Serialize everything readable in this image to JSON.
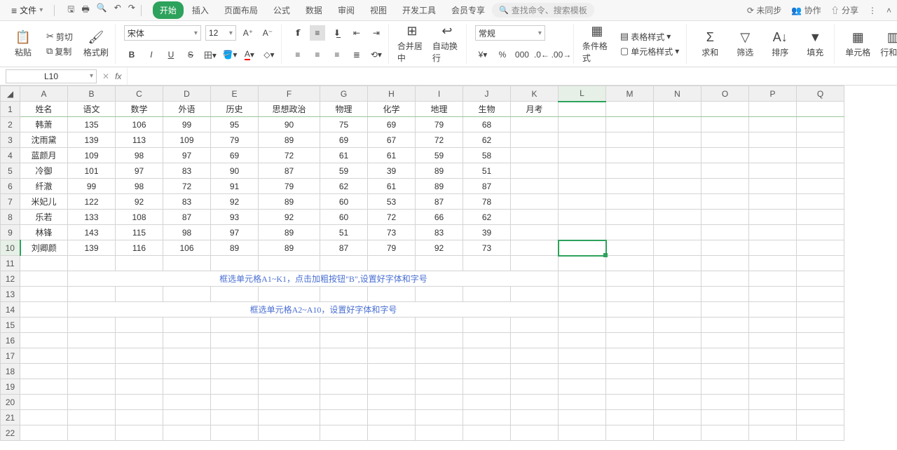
{
  "menubar": {
    "file": "文件",
    "tabs": [
      "开始",
      "插入",
      "页面布局",
      "公式",
      "数据",
      "审阅",
      "视图",
      "开发工具",
      "会员专享"
    ],
    "search_placeholder": "查找命令、搜索模板",
    "right": {
      "sync": "未同步",
      "collab": "协作",
      "share": "分享"
    }
  },
  "ribbon": {
    "paste": "粘贴",
    "cut": "剪切",
    "copy": "复制",
    "format_painter": "格式刷",
    "font_name": "宋体",
    "font_size": "12",
    "number_format": "常规",
    "merge_center": "合并居中",
    "wrap_text": "自动换行",
    "cond_format": "条件格式",
    "table_style": "表格样式",
    "cell_style": "单元格样式",
    "sum": "求和",
    "filter": "筛选",
    "sort": "排序",
    "fill": "填充",
    "cells": "单元格",
    "rowcol": "行和列"
  },
  "formula_bar": {
    "name_box": "L10",
    "fx": "fx"
  },
  "grid": {
    "columns": [
      "A",
      "B",
      "C",
      "D",
      "E",
      "F",
      "G",
      "H",
      "I",
      "J",
      "K",
      "L",
      "M",
      "N",
      "O",
      "P",
      "Q"
    ],
    "headers": [
      "姓名",
      "语文",
      "数学",
      "外语",
      "历史",
      "思想政治",
      "物理",
      "化学",
      "地理",
      "生物",
      "月考"
    ],
    "rows": [
      {
        "name": "韩萧",
        "v": [
          135,
          106,
          99,
          95,
          90,
          75,
          69,
          79,
          68
        ]
      },
      {
        "name": "沈雨黛",
        "v": [
          139,
          113,
          109,
          79,
          89,
          69,
          67,
          72,
          62
        ]
      },
      {
        "name": "蓝颜月",
        "v": [
          109,
          98,
          97,
          69,
          72,
          61,
          61,
          59,
          58
        ]
      },
      {
        "name": "冷御",
        "v": [
          101,
          97,
          83,
          90,
          87,
          59,
          39,
          89,
          51
        ]
      },
      {
        "name": "纤澈",
        "v": [
          99,
          98,
          72,
          91,
          79,
          62,
          61,
          89,
          87
        ]
      },
      {
        "name": "米妃儿",
        "v": [
          122,
          92,
          83,
          92,
          89,
          60,
          53,
          87,
          78
        ]
      },
      {
        "name": "乐若",
        "v": [
          133,
          108,
          87,
          93,
          92,
          60,
          72,
          66,
          62
        ]
      },
      {
        "name": "林锋",
        "v": [
          143,
          115,
          98,
          97,
          89,
          51,
          73,
          83,
          39
        ]
      },
      {
        "name": "刘卿颜",
        "v": [
          139,
          116,
          106,
          89,
          89,
          87,
          79,
          92,
          73
        ]
      }
    ],
    "annotations": [
      "框选单元格A1~K1，点击加粗按钮\"B\",设置好字体和字号",
      "框选单元格A2~A10，设置好字体和字号"
    ],
    "selected": {
      "col": "L",
      "row": 10
    }
  }
}
